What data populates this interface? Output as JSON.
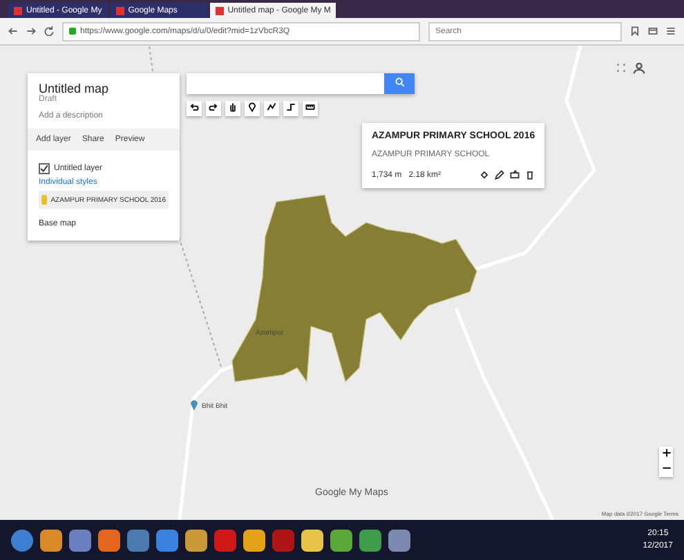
{
  "browser": {
    "tabs": [
      {
        "title": "Untitled - Google My",
        "selected": false
      },
      {
        "title": "Google Maps",
        "selected": false
      },
      {
        "title": "Untitled map - Google My M",
        "selected": true
      }
    ],
    "address": "https://www.google.com/maps/d/u/0/edit?mid=1zVbcR3Q",
    "search_placeholder": "Search"
  },
  "sidebar": {
    "title": "Untitled map",
    "subtitle": "Draft",
    "description": "Add a description",
    "actions": [
      "Add layer",
      "Share",
      "Preview"
    ],
    "layer": {
      "name": "Untitled layer",
      "checked": true,
      "style": "Individual styles",
      "items": [
        {
          "label": "AZAMPUR PRIMARY SCHOOL 2016",
          "selected": true
        }
      ]
    },
    "base_map": "Base map"
  },
  "popup": {
    "title": "AZAMPUR PRIMARY SCHOOL 2016",
    "subtitle": "AZAMPUR PRIMARY SCHOOL",
    "measures": [
      "1,734 m",
      "2.18 km²"
    ]
  },
  "map_labels": [
    {
      "kind": "polygon",
      "text": "Azampur"
    },
    {
      "kind": "pin",
      "text": "Bhit Bhit"
    }
  ],
  "brand": "Google My Maps",
  "attribution": "Map data ©2017 Google  Terms",
  "taskbar": {
    "time": "20:15",
    "date": "12/2017"
  }
}
